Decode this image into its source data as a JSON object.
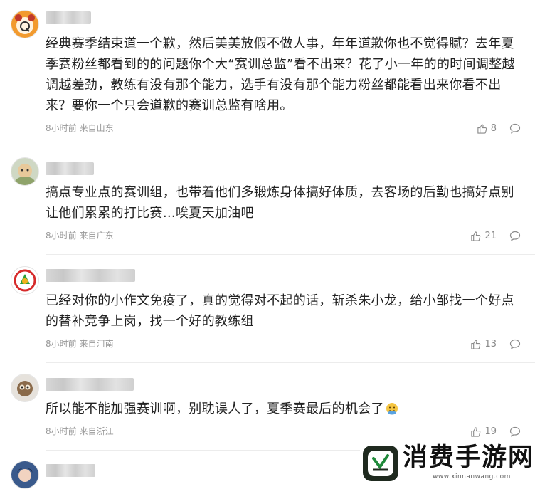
{
  "comments": [
    {
      "avatar": "panda-cartoon-avatar",
      "username": "███████",
      "text": "经典赛季结束道一个歉，然后美美放假不做人事，年年道歉你也不觉得腻？去年夏季赛粉丝都看到的的问题你个大“赛训总监”看不出来？花了小一年的的时间调整越调越差劲，教练有没有那个能力，选手有没有那个能力粉丝都能看出来你看不出来？要你一个只会道歉的赛训总监有啥用。",
      "time": "8小时前",
      "location": "来自山东",
      "likes": "8"
    },
    {
      "avatar": "cartoon-character-avatar",
      "username": "█████",
      "text": "搞点专业点的赛训组，也带着他们多锻炼身体搞好体质，去客场的后勤也搞好点别让他们累累的打比赛…唉夏天加油吧",
      "time": "8小时前",
      "location": "来自广东",
      "likes": "21"
    },
    {
      "avatar": "team-logo-avatar",
      "username": "████████",
      "text": "已经对你的小作文免疫了，真的觉得对不起的话，斩杀朱小龙，给小邹找一个好点的替补竞争上岗，找一个好的教练组",
      "time": "8小时前",
      "location": "来自河南",
      "likes": "13"
    },
    {
      "avatar": "monkey-avatar",
      "username": "████████",
      "text": "所以能不能加强赛训啊，别耽误人了，夏季赛最后的机会了",
      "emoji": "face-icon",
      "time": "8小时前",
      "location": "来自浙江",
      "likes": "19"
    },
    {
      "avatar": "anime-avatar",
      "username": "█████"
    }
  ],
  "watermark": {
    "name": "消费手游网",
    "url": "www.xinnanwang.com"
  },
  "colors": {
    "text": "#222222",
    "meta": "#999999",
    "divider": "#ececec"
  }
}
